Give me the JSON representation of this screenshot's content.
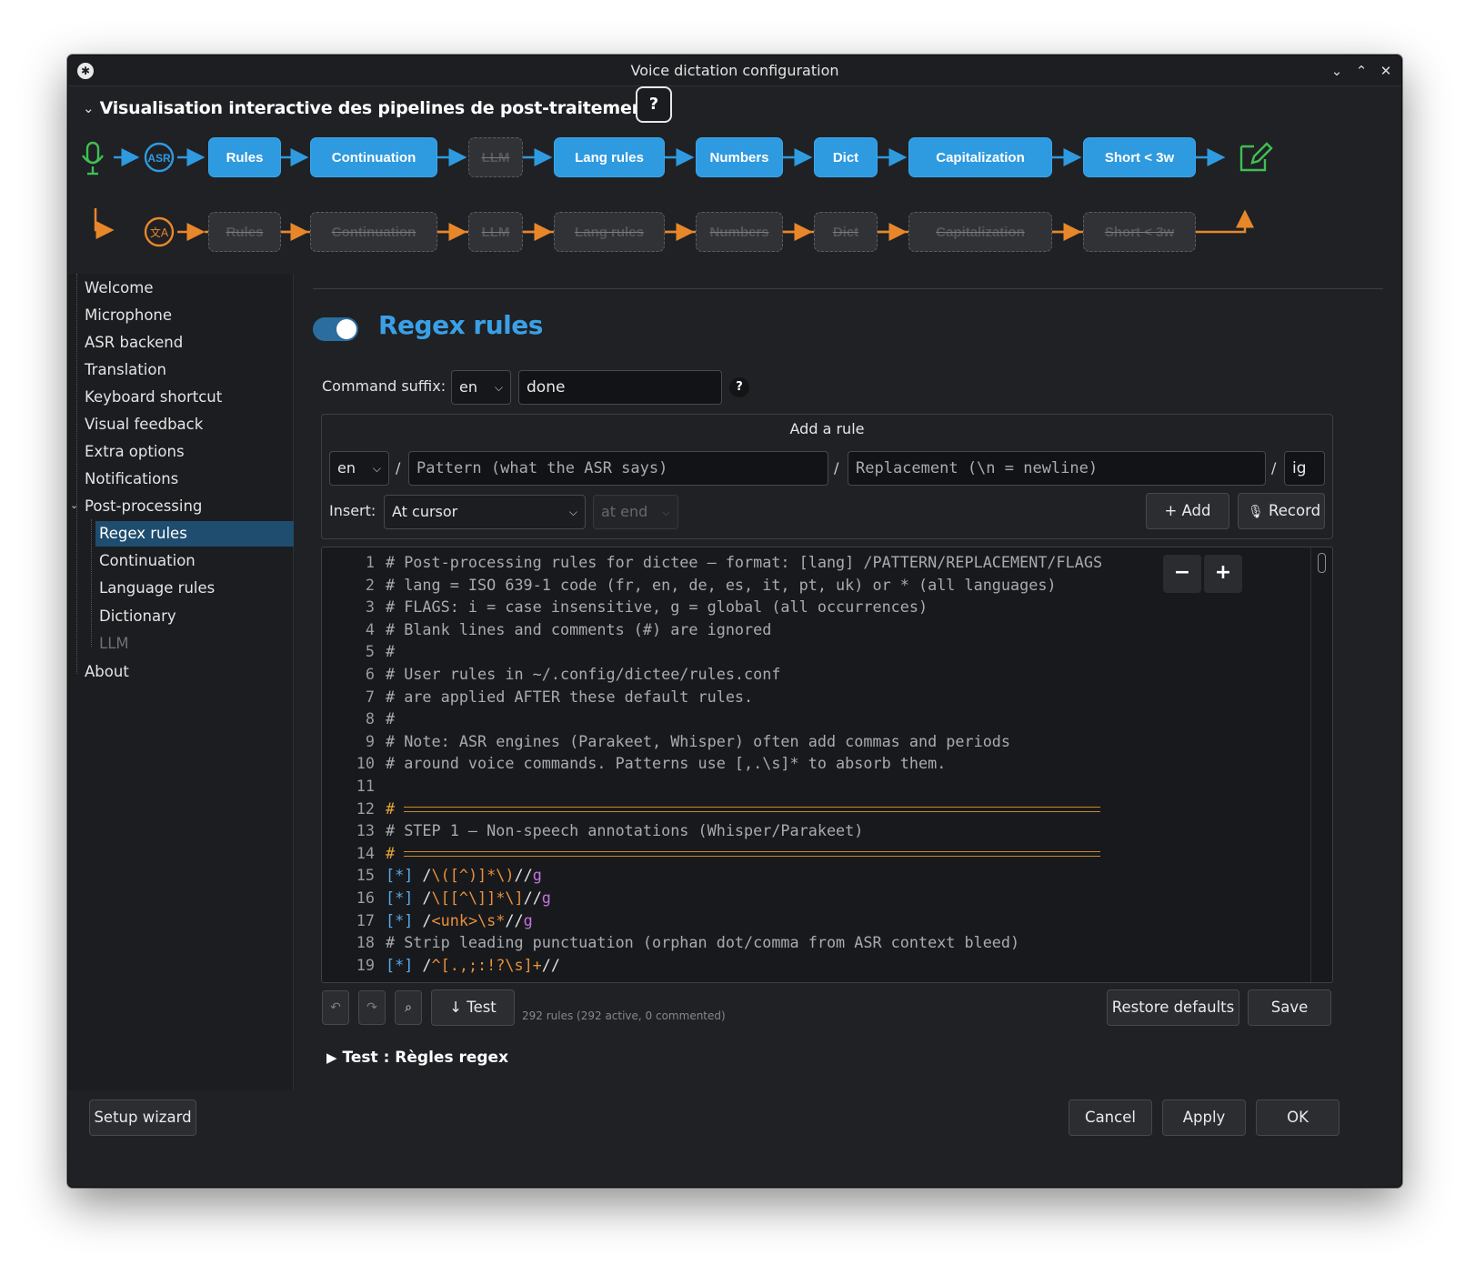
{
  "window": {
    "title": "Voice dictation configuration"
  },
  "pipeline": {
    "title": "Visualisation interactive des pipelines de post-traitement",
    "help_label": "?",
    "row1": [
      "Rules",
      "Continuation",
      "LLM",
      "Lang rules",
      "Numbers",
      "Dict",
      "Capitalization",
      "Short < 3w"
    ],
    "row2": [
      "Rules",
      "Continuation",
      "LLM",
      "Lang rules",
      "Numbers",
      "Dict",
      "Capitalization",
      "Short < 3w"
    ],
    "asr_badge": "ASR",
    "colors": {
      "active": "#2e9ae0",
      "translation": "#e8872a",
      "output": "#3fbf54",
      "mic": "#3fbf54"
    }
  },
  "sidebar": {
    "items": [
      {
        "label": "Welcome"
      },
      {
        "label": "Microphone"
      },
      {
        "label": "ASR backend"
      },
      {
        "label": "Translation"
      },
      {
        "label": "Keyboard shortcut"
      },
      {
        "label": "Visual feedback"
      },
      {
        "label": "Extra options"
      },
      {
        "label": "Notifications"
      },
      {
        "label": "Post-processing"
      },
      {
        "label": "Regex rules"
      },
      {
        "label": "Continuation"
      },
      {
        "label": "Language rules"
      },
      {
        "label": "Dictionary"
      },
      {
        "label": "LLM"
      },
      {
        "label": "About"
      }
    ]
  },
  "section": {
    "title": "Regex rules",
    "enabled": true
  },
  "suffix": {
    "label": "Command suffix:",
    "lang": "en",
    "value": "done",
    "help": "?"
  },
  "add_rule": {
    "title": "Add a rule",
    "lang": "en",
    "sep": "/",
    "pattern_placeholder": "Pattern (what the ASR says)",
    "replacement_placeholder": "Replacement (\\n = newline)",
    "flags": "ig",
    "insert_label": "Insert:",
    "insert_value": "At cursor",
    "position_value": "at end",
    "add_label": "+ Add",
    "record_label": "Record"
  },
  "editor": {
    "zoom_out": "−",
    "zoom_in": "+",
    "lines": [
      {
        "n": "1",
        "text": "# Post-processing rules for dictee — format: [lang] /PATTERN/REPLACEMENT/FLAGS"
      },
      {
        "n": "2",
        "text": "# lang = ISO 639-1 code (fr, en, de, es, it, pt, uk) or * (all languages)"
      },
      {
        "n": "3",
        "text": "# FLAGS: i = case insensitive, g = global (all occurrences)"
      },
      {
        "n": "4",
        "text": "# Blank lines and comments (#) are ignored"
      },
      {
        "n": "5",
        "text": "#"
      },
      {
        "n": "6",
        "text": "# User rules in ~/.config/dictee/rules.conf"
      },
      {
        "n": "7",
        "text": "# are applied AFTER these default rules."
      },
      {
        "n": "8",
        "text": "#"
      },
      {
        "n": "9",
        "text": "# Note: ASR engines (Parakeet, Whisper) often add commas and periods"
      },
      {
        "n": "10",
        "text": "# around voice commands. Patterns use [,.\\s]* to absorb them."
      },
      {
        "n": "11",
        "text": ""
      },
      {
        "n": "12",
        "text": "#"
      },
      {
        "n": "13",
        "text": "# STEP 1 — Non-speech annotations (Whisper/Parakeet)"
      },
      {
        "n": "14",
        "text": "#"
      },
      {
        "n": "15",
        "lang": "[*]",
        "pattern": "\\([^)]*\\)",
        "replacement": "",
        "flags": "g"
      },
      {
        "n": "16",
        "lang": "[*]",
        "pattern": "\\[[^\\]]*\\]",
        "replacement": "",
        "flags": "g"
      },
      {
        "n": "17",
        "lang": "[*]",
        "pattern": "<unk>\\s*",
        "replacement": "",
        "flags": "g"
      },
      {
        "n": "18",
        "text": "# Strip leading punctuation (orphan dot/comma from ASR context bleed)"
      },
      {
        "n": "19",
        "lang": "[*]",
        "pattern": "^[.,;:!?\\s]+",
        "replacement": "",
        "flags": ""
      }
    ]
  },
  "toolbar": {
    "test_label": "↓ Test",
    "rules_info": "292 rules (292 active, 0 commented)",
    "restore_label": "Restore defaults",
    "save_label": "Save"
  },
  "test_section": {
    "label": "Test : Règles regex"
  },
  "footer": {
    "wizard_label": "Setup wizard",
    "cancel_label": "Cancel",
    "apply_label": "Apply",
    "ok_label": "OK"
  }
}
